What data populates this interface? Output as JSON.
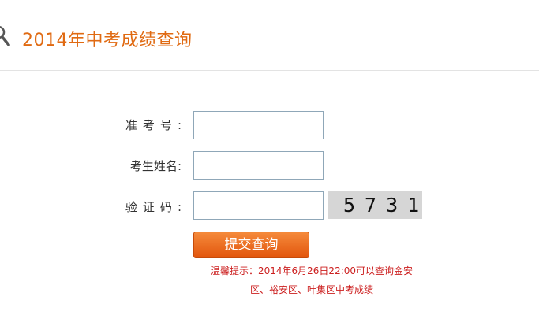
{
  "header": {
    "title": "2014年中考成绩查询",
    "icon": "search-icon"
  },
  "form": {
    "exam_number_label": "准考号",
    "name_label": "考生姓名",
    "captcha_label": "验证码",
    "colon": ":",
    "exam_number_value": "",
    "name_value": "",
    "captcha_value": "",
    "captcha_image_text": "5731",
    "submit_label": "提交查询"
  },
  "notice": {
    "line1": "温馨提示：2014年6月26日22:00可以查询金安",
    "line2": "区、裕安区、叶集区中考成绩"
  },
  "colors": {
    "title": "#e06a12",
    "button": "#e8661f",
    "notice": "#cc1f1f"
  }
}
